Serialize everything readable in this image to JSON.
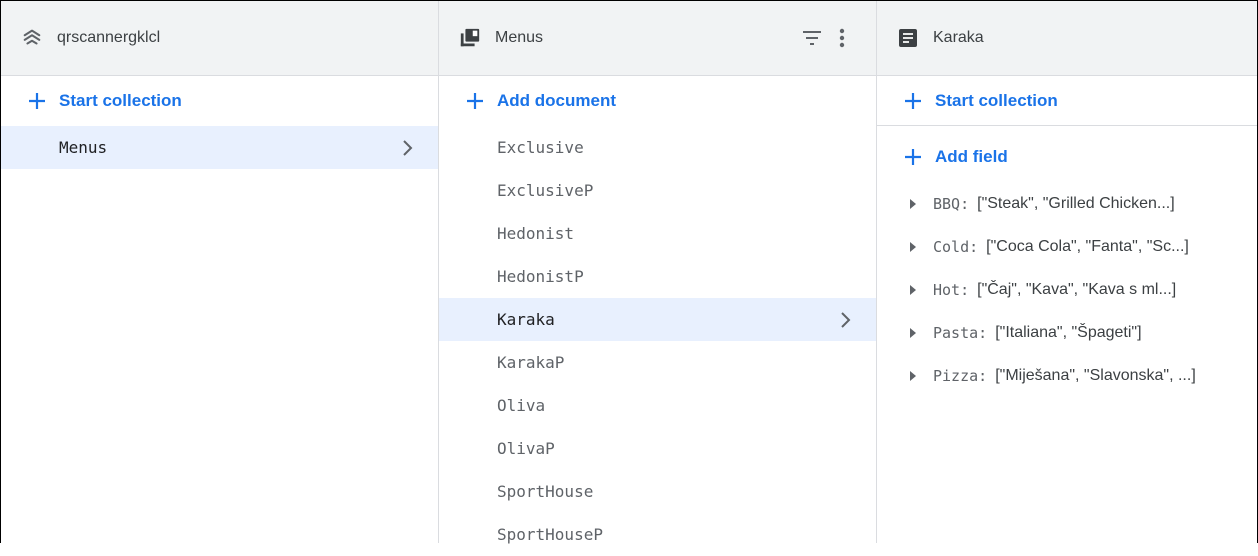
{
  "columns": {
    "root": {
      "title": "qrscannergklcl",
      "action_label": "Start collection",
      "items": [
        {
          "label": "Menus"
        }
      ]
    },
    "collection": {
      "title": "Menus",
      "action_label": "Add document",
      "items": [
        {
          "label": "Exclusive"
        },
        {
          "label": "ExclusiveP"
        },
        {
          "label": "Hedonist"
        },
        {
          "label": "HedonistP"
        },
        {
          "label": "Karaka"
        },
        {
          "label": "KarakaP"
        },
        {
          "label": "Oliva"
        },
        {
          "label": "OlivaP"
        },
        {
          "label": "SportHouse"
        },
        {
          "label": "SportHouseP"
        }
      ]
    },
    "document": {
      "title": "Karaka",
      "start_collection_label": "Start collection",
      "add_field_label": "Add field",
      "fields": [
        {
          "key": "BBQ",
          "value": "[\"Steak\", \"Grilled Chicken...]"
        },
        {
          "key": "Cold",
          "value": "[\"Coca Cola\", \"Fanta\", \"Sc...]"
        },
        {
          "key": "Hot",
          "value": "[\"Čaj\", \"Kava\", \"Kava s ml...]"
        },
        {
          "key": "Pasta",
          "value": "[\"Italiana\", \"Špageti\"]"
        },
        {
          "key": "Pizza",
          "value": "[\"Miješana\", \"Slavonska\", ...]"
        }
      ]
    }
  },
  "colors": {
    "accent": "#1a73e8",
    "selected_bg": "#e8f0fe",
    "header_bg": "#f1f3f4"
  },
  "icons": {
    "root": "firestore-stack-icon",
    "collection": "collection-icon",
    "document": "document-icon",
    "filter": "filter-icon",
    "more": "more-vert-icon"
  }
}
